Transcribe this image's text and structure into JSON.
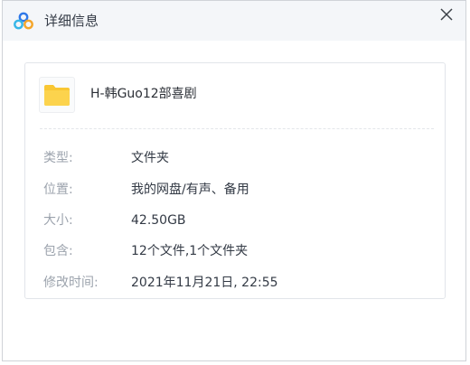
{
  "dialog": {
    "title": "详细信息"
  },
  "file": {
    "name": "H-韩Guo12部喜剧"
  },
  "details": [
    {
      "label": "类型:",
      "value": "文件夹"
    },
    {
      "label": "位置:",
      "value": "我的网盘/有声、备用"
    },
    {
      "label": "大小:",
      "value": "42.50GB"
    },
    {
      "label": "包含:",
      "value": "12个文件,1个文件夹"
    },
    {
      "label": "修改时间:",
      "value": "2021年11月21日, 22:55"
    }
  ],
  "colors": {
    "folder": "#f9c733",
    "logo_blue": "#2f78e8",
    "logo_cyan": "#36b6e8",
    "logo_orange": "#f4a52a"
  }
}
